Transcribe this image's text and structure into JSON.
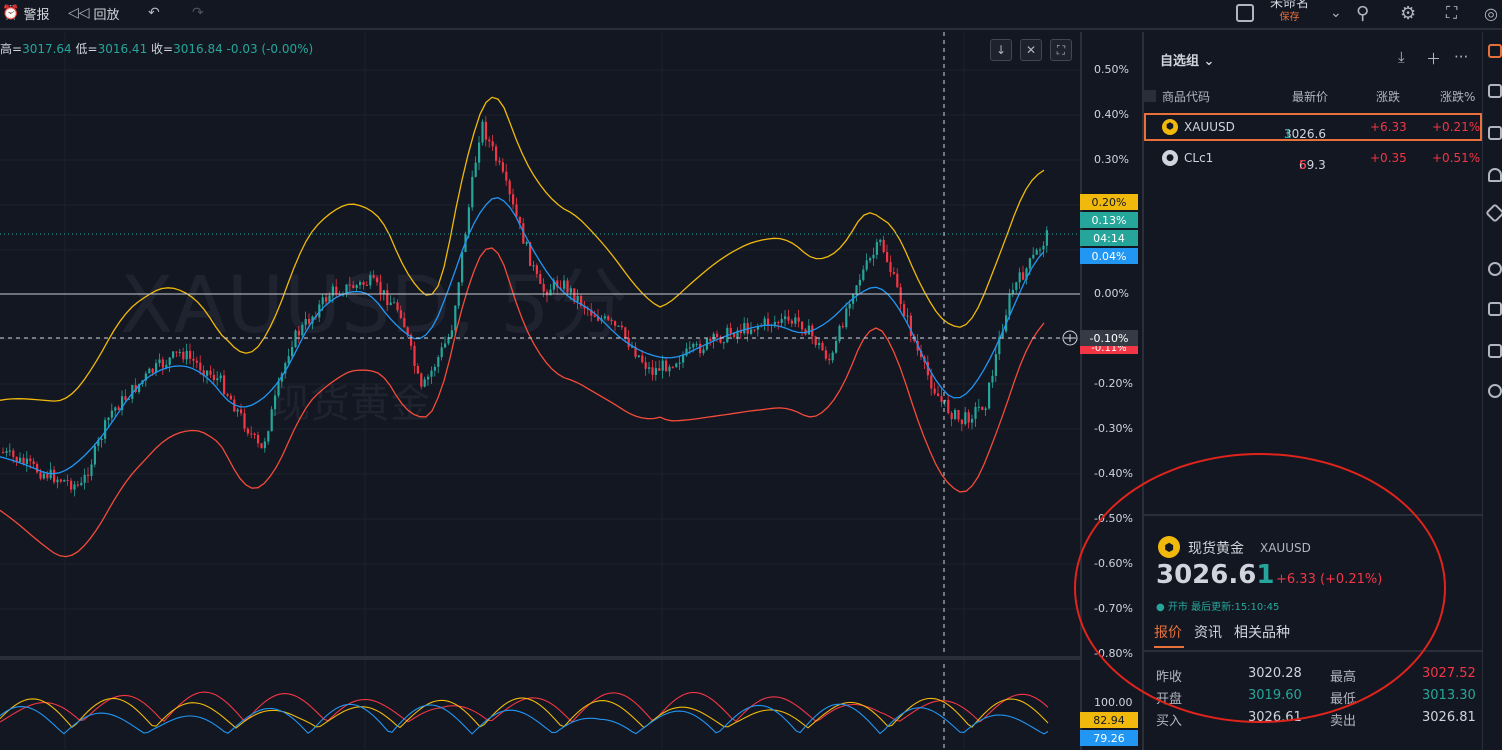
{
  "toolbar": {
    "alerts_label": "警报",
    "replay_label": "回放",
    "layout_name": "未命名",
    "layout_saved": "保存"
  },
  "chart": {
    "ohlc_prefix": "高=",
    "high": "3017.64",
    "low_label": "低=",
    "low": "3016.41",
    "close_label": "收=",
    "close": "3016.84",
    "change": "-0.03 (-0.00%)",
    "watermark_symbol": "XAUUSD, 5分",
    "watermark_name": "现货黄金",
    "scale_labels": [
      "0.50%",
      "0.40%",
      "0.30%",
      "0.00%",
      "-0.20%",
      "-0.30%",
      "-0.40%",
      "-0.50%",
      "-0.60%",
      "-0.70%",
      "-0.80%"
    ],
    "tag_yellow": "0.20%",
    "tag_green": "0.13%",
    "tag_countdown": "04:14",
    "tag_blue": "0.04%",
    "tag_crosshair": "-0.10%",
    "tag_red": "-0.11%",
    "osc_label_top": "100.00",
    "osc_tag_yellow": "82.94",
    "osc_tag_blue": "79.26"
  },
  "watchlist": {
    "title": "自选组",
    "columns": {
      "symbol": "商品代码",
      "last": "最新价",
      "change": "涨跌",
      "change_pct": "涨跌%"
    },
    "rows": [
      {
        "symbol": "XAUUSD",
        "last_main": "3026.6",
        "last_tail": "1",
        "change": "+6.33",
        "change_pct": "+0.21%"
      },
      {
        "symbol": "CLc1",
        "last_main": "69.3",
        "last_tail": "5",
        "change": "+0.35",
        "change_pct": "+0.51%"
      }
    ]
  },
  "detail": {
    "name": "现货黄金",
    "symbol": "XAUUSD",
    "price_main": "3026.6",
    "price_tail": "1",
    "change": "+6.33 (+0.21%)",
    "status": "● 开市  最后更新:15:10:45",
    "tabs": [
      "报价",
      "资讯",
      "相关品种"
    ],
    "stats": {
      "prev_close_label": "昨收",
      "prev_close": "3020.28",
      "high_label": "最高",
      "high": "3027.52",
      "open_label": "开盘",
      "open": "3019.60",
      "low_label": "最低",
      "low": "3013.30",
      "bid_label": "买入",
      "bid": "3026.61",
      "ask_label": "卖出",
      "ask": "3026.81"
    }
  },
  "colors": {
    "background": "#131722",
    "up": "#f23645",
    "down": "#26a69a",
    "upper_band": "#f0b90b",
    "mid_band": "#2196f3",
    "lower_band": "#f44b3a",
    "highlight": "#e8703a"
  }
}
